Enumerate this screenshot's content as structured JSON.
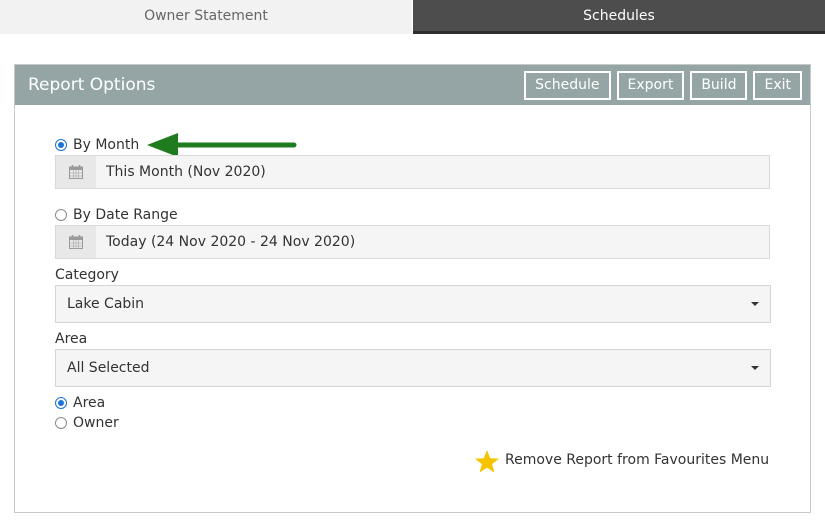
{
  "tabs": {
    "owner_statement": "Owner Statement",
    "schedules": "Schedules"
  },
  "panel": {
    "title": "Report Options",
    "buttons": {
      "schedule": "Schedule",
      "export": "Export",
      "build": "Build",
      "exit": "Exit"
    }
  },
  "period": {
    "by_month_label": "By Month",
    "by_month_selected": true,
    "month_value": "This Month (Nov 2020)",
    "by_date_range_label": "By Date Range",
    "date_range_value": "Today (24 Nov 2020 - 24 Nov 2020)"
  },
  "category": {
    "label": "Category",
    "selected": "Lake Cabin"
  },
  "area": {
    "label": "Area",
    "selected": "All Selected"
  },
  "grouping": {
    "area_label": "Area",
    "area_selected": true,
    "owner_label": "Owner"
  },
  "favourites": {
    "label": "Remove Report from Favourites Menu",
    "icon": "star-icon",
    "star_color": "#f5c400"
  },
  "colors": {
    "header_bg": "#95a5a6",
    "active_tab_bg": "#4d4d4d",
    "annotation_arrow": "#1e7b1e"
  }
}
